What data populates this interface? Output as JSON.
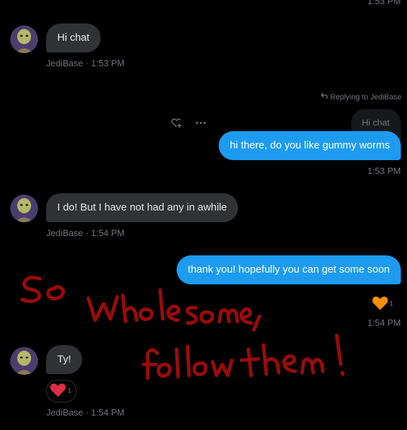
{
  "top_timestamp": "1:53 PM",
  "messages": [
    {
      "text": "Hi chat",
      "meta": "JediBase · 1:53 PM"
    },
    {
      "reply_label": "Replying to JediBase",
      "quoted": "Hi chat",
      "text": "hi there, do you like gummy worms",
      "meta": "1:53 PM"
    },
    {
      "text": "I do! But I have not had any in awhile",
      "meta": "JediBase · 1:54 PM"
    },
    {
      "text": "thank you! hopefully you can get some soon",
      "reaction_count": "1",
      "reaction_icon": "orange-heart-icon",
      "meta": "1:54 PM"
    },
    {
      "text": "Ty!",
      "reaction_count": "1",
      "reaction_icon": "red-heart-icon",
      "meta": "JediBase · 1:54 PM"
    }
  ],
  "overlay_text": "So Wholesome, follow them!",
  "colors": {
    "sent_bubble": "#1d9bf0",
    "received_bubble": "#2f3336",
    "muted_text": "#71767b",
    "scribble": "#9b0b0b"
  }
}
